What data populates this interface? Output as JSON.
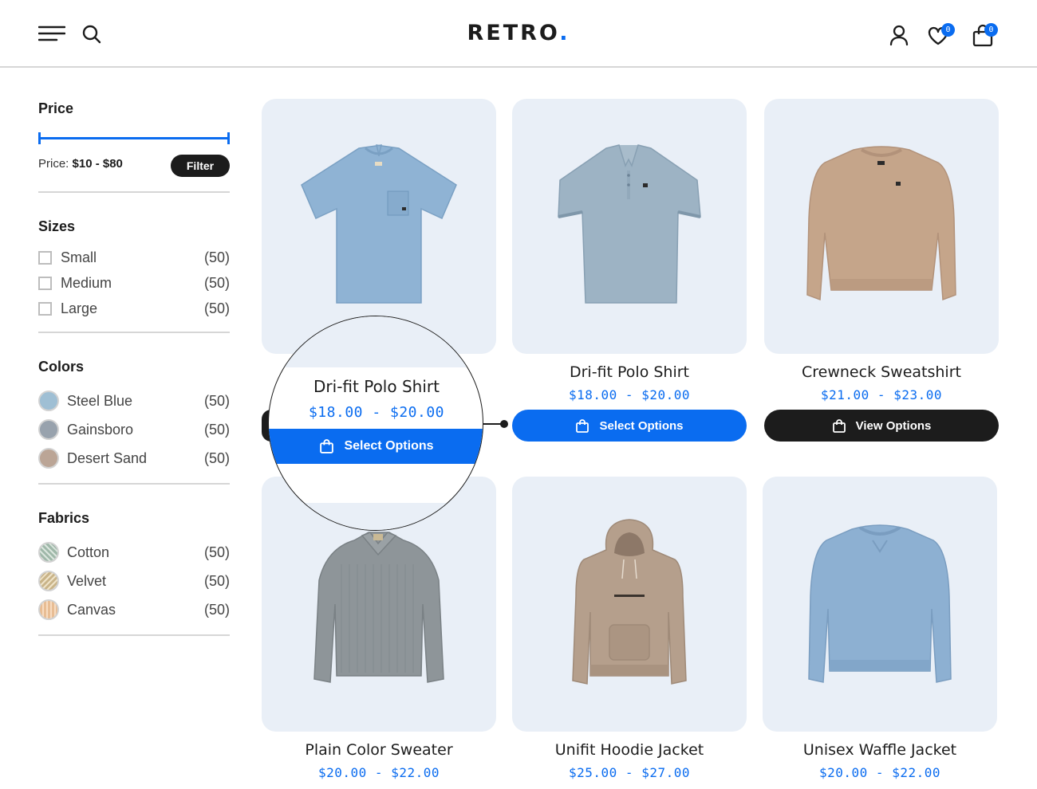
{
  "header": {
    "logo_text": "RETRO",
    "logo_dot": ".",
    "wishlist_count": "0",
    "cart_count": "0",
    "icons": [
      "menu-icon",
      "search-icon",
      "user-icon",
      "heart-icon",
      "bag-icon"
    ]
  },
  "sidebar": {
    "price": {
      "title": "Price",
      "label": "Price:",
      "range_text": "$10 - $80",
      "filter_label": "Filter"
    },
    "sizes": {
      "title": "Sizes",
      "items": [
        {
          "label": "Small",
          "count": "(50)"
        },
        {
          "label": "Medium",
          "count": "(50)"
        },
        {
          "label": "Large",
          "count": "(50)"
        }
      ]
    },
    "colors": {
      "title": "Colors",
      "items": [
        {
          "label": "Steel Blue",
          "count": "(50)",
          "color": "#9fbfd4"
        },
        {
          "label": "Gainsboro",
          "count": "(50)",
          "color": "#98a2ad"
        },
        {
          "label": "Desert Sand",
          "count": "(50)",
          "color": "#bba596"
        }
      ]
    },
    "fabrics": {
      "title": "Fabrics",
      "items": [
        {
          "label": "Cotton",
          "count": "(50)",
          "color": "#9fb8a9"
        },
        {
          "label": "Velvet",
          "count": "(50)",
          "color": "#c9b489"
        },
        {
          "label": "Canvas",
          "count": "(50)",
          "color": "#e8bd94"
        }
      ]
    }
  },
  "products": [
    {
      "name": "Dri-fit Polo Shirt",
      "price": "$18.00 - $20.00",
      "image": "pocket-tshirt"
    },
    {
      "name": "Dri-fit Polo Shirt",
      "price": "$18.00 - $20.00",
      "button": "Select Options",
      "image": "polo-shirt"
    },
    {
      "name": "Crewneck Sweatshirt",
      "price": "$21.00 - $23.00",
      "button": "View Options",
      "image": "crewneck-sweatshirt"
    },
    {
      "name": "Plain Color Sweater",
      "price": "$20.00 - $22.00",
      "image": "collared-sweater"
    },
    {
      "name": "Unifit Hoodie Jacket",
      "price": "$25.00 - $27.00",
      "image": "hoodie"
    },
    {
      "name": "Unisex Waffle Jacket",
      "price": "$20.00 - $22.00",
      "image": "waffle-sweater"
    }
  ],
  "magnifier": {
    "name": "Dri-fit Polo Shirt",
    "price": "$18.00 - $20.00",
    "button": "Select Options"
  },
  "colors": {
    "accent": "#0a6cf0",
    "dark": "#1c1c1c",
    "card_bg": "#e9eff7"
  }
}
